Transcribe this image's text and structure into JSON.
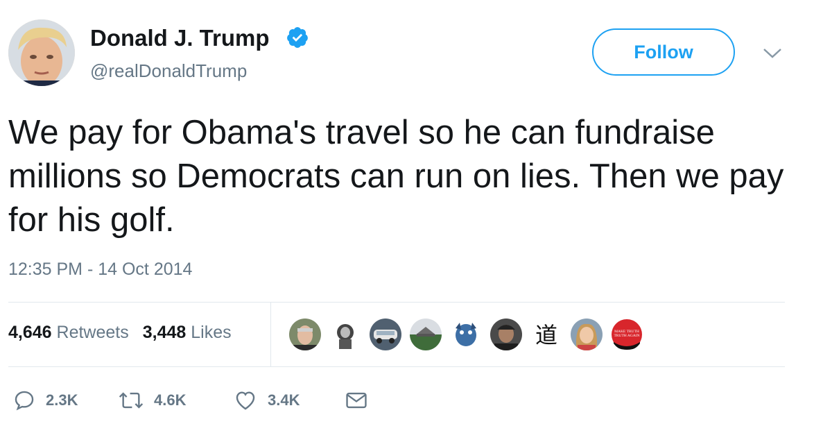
{
  "user": {
    "display_name": "Donald J. Trump",
    "handle": "@realDonaldTrump",
    "verified_icon": "verified-badge-icon",
    "accent_color": "#1da1f2"
  },
  "header": {
    "follow_label": "Follow",
    "menu_icon": "chevron-down-icon"
  },
  "tweet": {
    "text": "We pay for Obama's travel so he can fundraise millions so Democrats can run on lies. Then we pay for his golf.",
    "timestamp": "12:35 PM - 14 Oct 2014"
  },
  "stats": {
    "retweets_count": "4,646",
    "retweets_label": "Retweets",
    "likes_count": "3,448",
    "likes_label": "Likes"
  },
  "likers": {
    "hat_text_line1": "MAKE TRUTH",
    "hat_text_line2": "TRUTH AGAIN",
    "kanji": "道"
  },
  "actions": {
    "reply_count": "2.3K",
    "retweet_count": "4.6K",
    "like_count": "3.4K",
    "reply_icon": "reply-icon",
    "retweet_icon": "retweet-icon",
    "like_icon": "heart-icon",
    "dm_icon": "envelope-icon"
  }
}
